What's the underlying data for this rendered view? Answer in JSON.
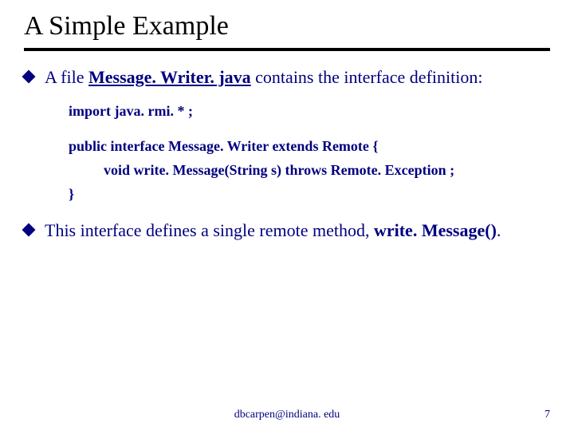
{
  "title": "A Simple Example",
  "bullets": [
    {
      "pre": "A file ",
      "filename": "Message. Writer. java",
      "post": " contains the interface definition:"
    },
    {
      "line1": "This interface defines a single remote method, ",
      "method": "write. Message()",
      "post": "."
    }
  ],
  "code": {
    "l1": "import java. rmi. * ;",
    "l2": "public interface  Message. Writer  extends Remote {",
    "l3": "void  write. Message(String s)  throws Remote. Exception ;",
    "l4": "}"
  },
  "footer": {
    "center": "dbcarpen@indiana. edu",
    "right": "7"
  }
}
